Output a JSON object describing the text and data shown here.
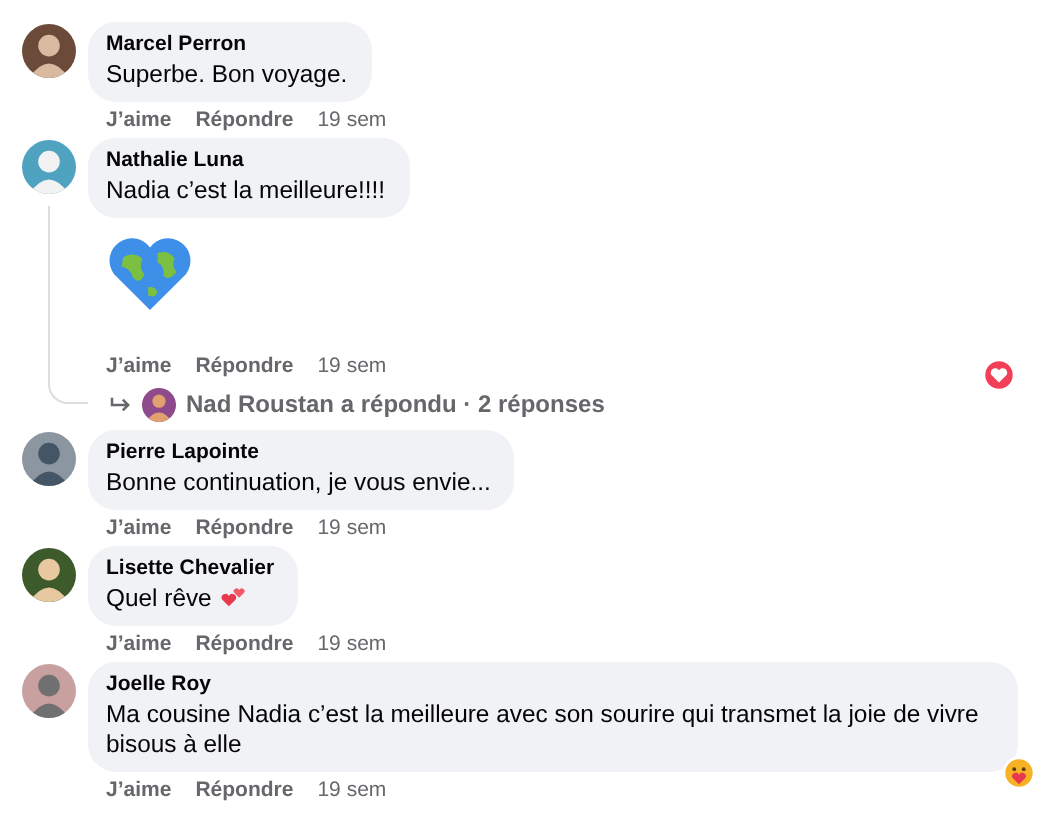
{
  "comments": [
    {
      "author": "Marcel Perron",
      "text": "Superbe. Bon voyage.",
      "actions": {
        "like": "J’aime",
        "reply": "Répondre",
        "time": "19 sem"
      }
    },
    {
      "author": "Nathalie Luna",
      "text": "Nadia c’est la meilleure!!!!",
      "sticker": true,
      "loved": true,
      "actions": {
        "like": "J’aime",
        "reply": "Répondre",
        "time": "19 sem"
      },
      "replies": "Nad Roustan a répondu · 2 réponses"
    },
    {
      "author": "Pierre Lapointe",
      "text": "Bonne continuation, je vous envie...",
      "actions": {
        "like": "J’aime",
        "reply": "Répondre",
        "time": "19 sem"
      }
    },
    {
      "author": "Lisette Chevalier",
      "text": "Quel rêve",
      "hearts_emoji": true,
      "actions": {
        "like": "J’aime",
        "reply": "Répondre",
        "time": "19 sem"
      }
    },
    {
      "author": "Joelle Roy",
      "text": "Ma cousine Nadia c’est la meilleure avec son sourire qui transmet la joie de vivre bisous à elle",
      "hugged": true,
      "actions": {
        "like": "J’aime",
        "reply": "Répondre",
        "time": "19 sem"
      }
    }
  ]
}
